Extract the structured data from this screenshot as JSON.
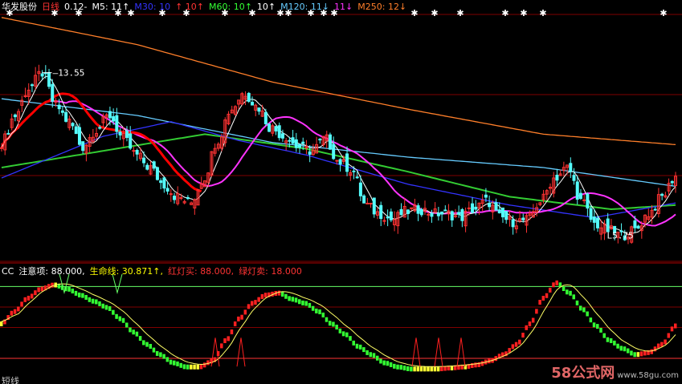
{
  "header": {
    "stock_name": "华发股份",
    "period": "日线",
    "price_change": "0.12-",
    "ma_items": [
      {
        "label": "M5: 11↑",
        "color": "#ffffff"
      },
      {
        "label": "M30: 10",
        "color": "#3333ff"
      },
      {
        "label": "↑ 10↑",
        "color": "#ff3333"
      },
      {
        "label": "M60: 10↑",
        "color": "#33ff33"
      },
      {
        "label": "10↑",
        "color": "#ffffff"
      },
      {
        "label": "M120: 11↓",
        "color": "#66ccff"
      },
      {
        "label": "11↓",
        "color": "#ff33ff"
      },
      {
        "label": "M250: 12↓",
        "color": "#ff7f2a"
      }
    ]
  },
  "indicator_header": {
    "items": [
      {
        "label": "CC",
        "color": "#ffffff"
      },
      {
        "label": "注意项: 88.000,",
        "color": "#ffffff"
      },
      {
        "label": "生命线: 30.871↑,",
        "color": "#ffff00"
      },
      {
        "label": "红灯买: 88.000,",
        "color": "#ff3333"
      },
      {
        "label": "绿灯卖: 18.000",
        "color": "#ff3333"
      }
    ]
  },
  "price_labels": {
    "high": "13.55",
    "low": "5.75"
  },
  "bottom_tab": "短线",
  "watermark": {
    "big": "58公式网",
    "small": "www.58gu.com"
  },
  "colors": {
    "up": "#ff3333",
    "down": "#54fcfc",
    "m5": "#ffffff",
    "m30": "#3333ff",
    "m60": "#33cc33",
    "m120": "#66ccff",
    "m250": "#ff7f2a",
    "pink": "#ff33ff",
    "ma_red": "#ff0000",
    "grid": "#800000",
    "bar_red": "#ff2020",
    "bar_green": "#33ff33",
    "bar_yellow": "#ffff33",
    "lifeline": "#ffff66"
  },
  "chart_data": [
    {
      "type": "line",
      "name_hint": "price",
      "x_count": 200,
      "y_axis": "price",
      "ylim": [
        4.5,
        16.5
      ],
      "series": [
        {
          "name": "M250",
          "x": [
            0,
            40,
            80,
            120,
            160,
            199
          ],
          "values": [
            16.2,
            14.9,
            13.1,
            11.8,
            10.6,
            10.1
          ]
        },
        {
          "name": "M120",
          "x": [
            0,
            40,
            80,
            120,
            160,
            199
          ],
          "values": [
            12.3,
            11.5,
            10.2,
            9.5,
            9.0,
            8.1
          ]
        },
        {
          "name": "M60",
          "x": [
            0,
            30,
            60,
            90,
            120,
            150,
            180,
            199
          ],
          "values": [
            9.0,
            9.8,
            10.6,
            9.9,
            8.8,
            7.6,
            7.0,
            7.2
          ]
        },
        {
          "name": "M30",
          "x": [
            0,
            30,
            50,
            70,
            90,
            120,
            150,
            175,
            199
          ],
          "values": [
            8.5,
            10.5,
            11.2,
            10.3,
            9.6,
            8.2,
            7.2,
            6.6,
            7.3
          ]
        }
      ],
      "price_path": [
        10.2,
        11.5,
        12.8,
        13.55,
        12.0,
        11.2,
        10.0,
        10.8,
        11.5,
        10.4,
        9.6,
        9.0,
        8.2,
        7.6,
        7.3,
        8.5,
        10.3,
        11.8,
        12.6,
        11.9,
        10.9,
        10.5,
        10.0,
        9.8,
        10.4,
        9.3,
        8.9,
        7.2,
        6.8,
        6.5,
        6.9,
        7.0,
        6.8,
        6.8,
        6.6,
        7.0,
        7.4,
        6.6,
        6.4,
        6.5,
        7.4,
        8.5,
        9.0,
        7.4,
        6.3,
        6.0,
        5.75,
        6.0,
        6.8,
        7.6,
        8.6
      ]
    },
    {
      "type": "bar",
      "name_hint": "indicator",
      "x_count": 200,
      "ylim": [
        0,
        100
      ],
      "levels": {
        "注意项": 88.0,
        "生命线": 30.871,
        "红灯买": 88.0,
        "绿灯卖": 18.0
      },
      "oscillator_path": [
        50,
        62,
        75,
        84,
        88,
        84,
        78,
        72,
        66,
        55,
        42,
        30,
        20,
        12,
        8,
        8,
        14,
        34,
        55,
        70,
        78,
        80,
        74,
        70,
        62,
        50,
        40,
        28,
        20,
        12,
        8,
        6,
        6,
        6,
        7,
        8,
        10,
        14,
        20,
        30,
        50,
        75,
        90,
        80,
        64,
        48,
        34,
        26,
        20,
        22,
        30,
        48
      ]
    }
  ]
}
